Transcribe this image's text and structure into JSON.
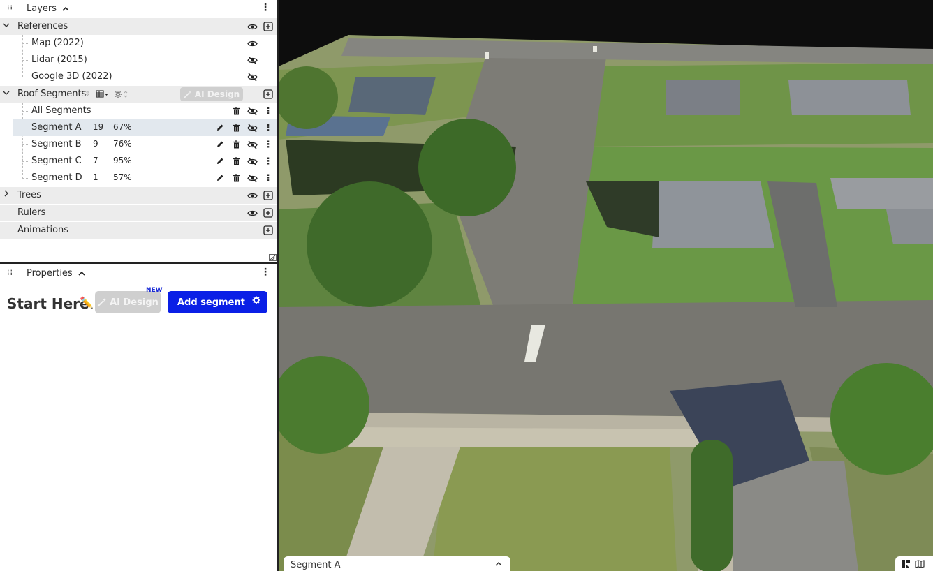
{
  "layers_panel": {
    "title": "Layers",
    "groups": {
      "references": {
        "label": "References"
      },
      "roof_segments": {
        "label": "Roof Segments",
        "ai_design_label": "AI Design"
      },
      "trees": {
        "label": "Trees"
      },
      "rulers": {
        "label": "Rulers"
      },
      "animations": {
        "label": "Animations"
      }
    },
    "references": [
      {
        "label": "Map (2022)",
        "visible": true
      },
      {
        "label": "Lidar (2015)",
        "visible": false
      },
      {
        "label": "Google 3D (2022)",
        "visible": false
      }
    ],
    "all_segments_label": "All Segments",
    "segments": [
      {
        "label": "Segment A",
        "count": "19",
        "percent": "67%"
      },
      {
        "label": "Segment B",
        "count": "9",
        "percent": "76%"
      },
      {
        "label": "Segment C",
        "count": "7",
        "percent": "95%"
      },
      {
        "label": "Segment D",
        "count": "1",
        "percent": "57%"
      }
    ]
  },
  "properties_panel": {
    "title": "Properties",
    "heading": "Start Here",
    "ai_design_label": "AI Design",
    "new_badge": "NEW",
    "add_segment_label": "Add segment"
  },
  "map_view": {
    "bottom_bar_label": "Segment A"
  },
  "colors": {
    "primary_button": "#0a1fe6",
    "disabled_button": "#cfcfcf",
    "selected_row": "#e2e8ee",
    "group_row": "#ececec"
  }
}
